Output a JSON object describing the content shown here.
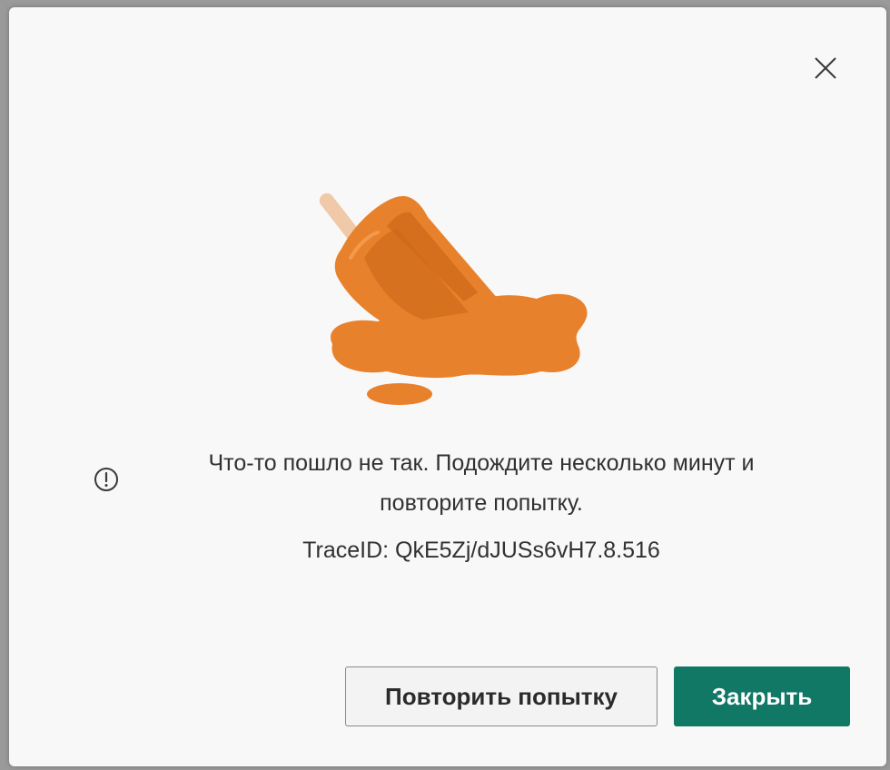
{
  "dialog": {
    "message": "Что-то пошло не так. Подождите несколько минут и повторите попытку.",
    "trace_id": "TraceID: QkE5Zj/dJUSs6vH7.8.516",
    "retry_label": "Повторить попытку",
    "close_label": "Закрыть",
    "close_icon": "close-icon",
    "info_icon": "info-icon",
    "illustration": "melted-popsicle"
  },
  "colors": {
    "accent": "#117865",
    "popsicle": "#e8812c"
  }
}
